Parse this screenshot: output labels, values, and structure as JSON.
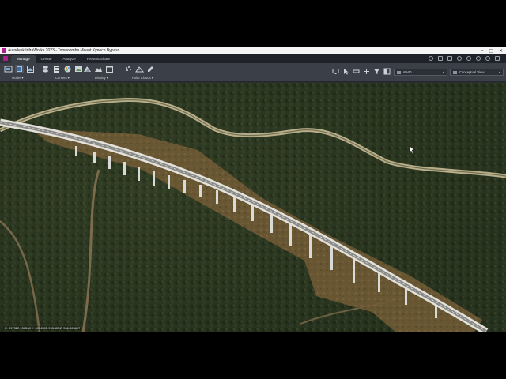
{
  "window": {
    "title": "Autodesk InfraWorks 2023 - Toowoomba Mount Kynoch Bypass",
    "controls": [
      "–",
      "▢",
      "✕"
    ]
  },
  "ribbon": {
    "tabs": [
      {
        "label": "Manage",
        "active": true
      },
      {
        "label": "Create",
        "active": false
      },
      {
        "label": "Analyze",
        "active": false
      },
      {
        "label": "Present/Share",
        "active": false
      }
    ],
    "groups": {
      "model": "Model",
      "content": "Content",
      "display": "Display",
      "point_clouds": "Point Clouds"
    },
    "scenario_select": "start0",
    "view_select": "Conceptual View"
  },
  "viewport": {
    "coordinates": "X: 397322.156568 Y: 6954555.993482 Z: 566.863607"
  },
  "colors": {
    "accent": "#b0208a",
    "ribbon_bg": "#3b4048",
    "tab_bg": "#1f2329"
  }
}
